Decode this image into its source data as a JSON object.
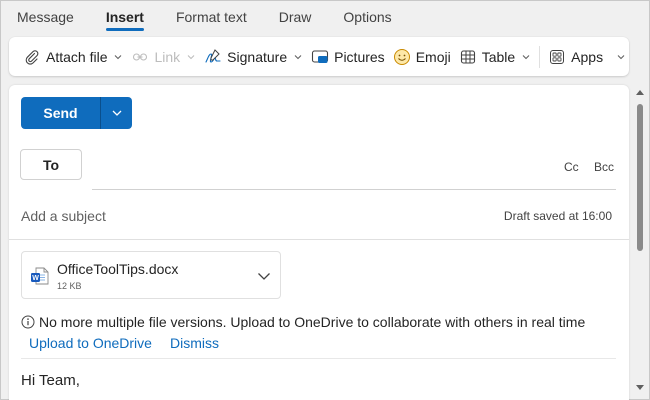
{
  "tabs": [
    {
      "label": "Message",
      "active": false
    },
    {
      "label": "Insert",
      "active": true
    },
    {
      "label": "Format text",
      "active": false
    },
    {
      "label": "Draw",
      "active": false
    },
    {
      "label": "Options",
      "active": false
    }
  ],
  "ribbon": {
    "attach_file": "Attach file",
    "link": "Link",
    "signature": "Signature",
    "pictures": "Pictures",
    "emoji": "Emoji",
    "table": "Table",
    "apps": "Apps"
  },
  "compose": {
    "send_label": "Send",
    "to_label": "To",
    "cc_label": "Cc",
    "bcc_label": "Bcc",
    "subject_placeholder": "Add a subject",
    "draft_status": "Draft saved at 16:00",
    "attachment": {
      "name": "OfficeToolTips.docx",
      "size": "12 KB"
    },
    "info_message": "No more multiple file versions. Upload to OneDrive to collaborate with others in real time",
    "upload_link": "Upload to OneDrive",
    "dismiss_link": "Dismiss",
    "body_text": "Hi Team,"
  },
  "colors": {
    "accent": "#0f6cbd",
    "background": "#f0f0f0",
    "word_blue": "#185abd"
  }
}
